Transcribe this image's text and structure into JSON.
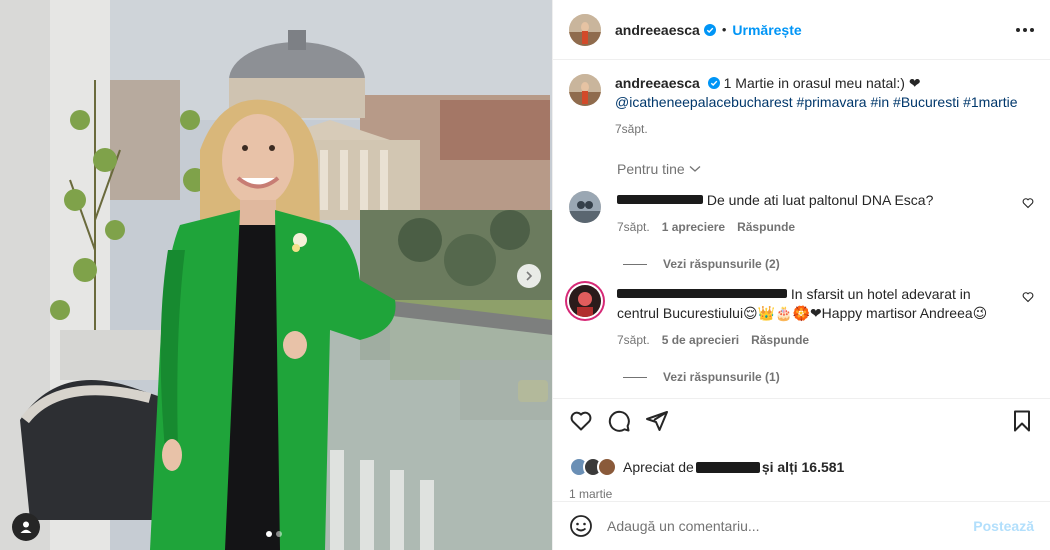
{
  "post_author": {
    "username": "andreeaesca",
    "follow_label": "Urmărește"
  },
  "caption": {
    "username": "andreeaesca",
    "text": "1 Martie in orasul meu natal:) ❤",
    "tags": "@icatheneepalacebucharest #primavara #in #Bucuresti #1martie",
    "time": "7săpt."
  },
  "for_you_label": "Pentru tine",
  "comments": [
    {
      "text": "De unde ati luat paltonul DNA Esca?",
      "time": "7săpt.",
      "likes": "1 apreciere",
      "reply_label": "Răspunde",
      "view_replies": "Vezi răspunsurile (2)"
    },
    {
      "text": "In sfarsit un hotel adevarat in centrul Bucurestiului😌👑🎂🏵️❤Happy martisor Andreea😉",
      "time": "7săpt.",
      "likes": "5 de aprecieri",
      "reply_label": "Răspunde",
      "view_replies": "Vezi răspunsurile (1)"
    }
  ],
  "likes": {
    "prefix": "Apreciat de",
    "suffix": "și alți 16.581"
  },
  "post_date": "1 martie",
  "add_comment": {
    "placeholder": "Adaugă un comentariu...",
    "post_label": "Postează"
  },
  "colors": {
    "accent": "#0095f6",
    "coat": "#1fa43a"
  },
  "icons": [
    "verified-icon",
    "more-icon",
    "heart-icon",
    "comment-icon",
    "share-icon",
    "bookmark-icon",
    "emoji-icon",
    "chevron-right-icon",
    "user-tag-icon"
  ]
}
